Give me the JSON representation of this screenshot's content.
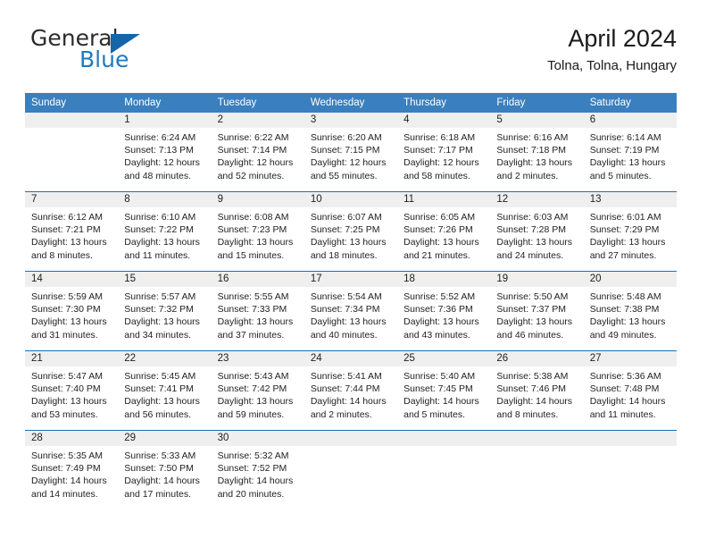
{
  "brand": {
    "name_part1": "General",
    "name_part2": "Blue",
    "logo_icon": "triangle-logo-icon"
  },
  "header": {
    "title": "April 2024",
    "location": "Tolna, Tolna, Hungary"
  },
  "colors": {
    "header_blue": "#3a7fbe",
    "row_separator_blue": "#1f6fb5",
    "daynum_band_gray": "#efefef",
    "brand_blue": "#1f7ac0",
    "logo_blue": "#1565a8"
  },
  "weekdays": [
    "Sunday",
    "Monday",
    "Tuesday",
    "Wednesday",
    "Thursday",
    "Friday",
    "Saturday"
  ],
  "weeks": [
    {
      "days": [
        {
          "num": "",
          "sunrise": "",
          "sunset": "",
          "daylight1": "",
          "daylight2": ""
        },
        {
          "num": "1",
          "sunrise": "Sunrise: 6:24 AM",
          "sunset": "Sunset: 7:13 PM",
          "daylight1": "Daylight: 12 hours",
          "daylight2": "and 48 minutes."
        },
        {
          "num": "2",
          "sunrise": "Sunrise: 6:22 AM",
          "sunset": "Sunset: 7:14 PM",
          "daylight1": "Daylight: 12 hours",
          "daylight2": "and 52 minutes."
        },
        {
          "num": "3",
          "sunrise": "Sunrise: 6:20 AM",
          "sunset": "Sunset: 7:15 PM",
          "daylight1": "Daylight: 12 hours",
          "daylight2": "and 55 minutes."
        },
        {
          "num": "4",
          "sunrise": "Sunrise: 6:18 AM",
          "sunset": "Sunset: 7:17 PM",
          "daylight1": "Daylight: 12 hours",
          "daylight2": "and 58 minutes."
        },
        {
          "num": "5",
          "sunrise": "Sunrise: 6:16 AM",
          "sunset": "Sunset: 7:18 PM",
          "daylight1": "Daylight: 13 hours",
          "daylight2": "and 2 minutes."
        },
        {
          "num": "6",
          "sunrise": "Sunrise: 6:14 AM",
          "sunset": "Sunset: 7:19 PM",
          "daylight1": "Daylight: 13 hours",
          "daylight2": "and 5 minutes."
        }
      ]
    },
    {
      "days": [
        {
          "num": "7",
          "sunrise": "Sunrise: 6:12 AM",
          "sunset": "Sunset: 7:21 PM",
          "daylight1": "Daylight: 13 hours",
          "daylight2": "and 8 minutes."
        },
        {
          "num": "8",
          "sunrise": "Sunrise: 6:10 AM",
          "sunset": "Sunset: 7:22 PM",
          "daylight1": "Daylight: 13 hours",
          "daylight2": "and 11 minutes."
        },
        {
          "num": "9",
          "sunrise": "Sunrise: 6:08 AM",
          "sunset": "Sunset: 7:23 PM",
          "daylight1": "Daylight: 13 hours",
          "daylight2": "and 15 minutes."
        },
        {
          "num": "10",
          "sunrise": "Sunrise: 6:07 AM",
          "sunset": "Sunset: 7:25 PM",
          "daylight1": "Daylight: 13 hours",
          "daylight2": "and 18 minutes."
        },
        {
          "num": "11",
          "sunrise": "Sunrise: 6:05 AM",
          "sunset": "Sunset: 7:26 PM",
          "daylight1": "Daylight: 13 hours",
          "daylight2": "and 21 minutes."
        },
        {
          "num": "12",
          "sunrise": "Sunrise: 6:03 AM",
          "sunset": "Sunset: 7:28 PM",
          "daylight1": "Daylight: 13 hours",
          "daylight2": "and 24 minutes."
        },
        {
          "num": "13",
          "sunrise": "Sunrise: 6:01 AM",
          "sunset": "Sunset: 7:29 PM",
          "daylight1": "Daylight: 13 hours",
          "daylight2": "and 27 minutes."
        }
      ]
    },
    {
      "days": [
        {
          "num": "14",
          "sunrise": "Sunrise: 5:59 AM",
          "sunset": "Sunset: 7:30 PM",
          "daylight1": "Daylight: 13 hours",
          "daylight2": "and 31 minutes."
        },
        {
          "num": "15",
          "sunrise": "Sunrise: 5:57 AM",
          "sunset": "Sunset: 7:32 PM",
          "daylight1": "Daylight: 13 hours",
          "daylight2": "and 34 minutes."
        },
        {
          "num": "16",
          "sunrise": "Sunrise: 5:55 AM",
          "sunset": "Sunset: 7:33 PM",
          "daylight1": "Daylight: 13 hours",
          "daylight2": "and 37 minutes."
        },
        {
          "num": "17",
          "sunrise": "Sunrise: 5:54 AM",
          "sunset": "Sunset: 7:34 PM",
          "daylight1": "Daylight: 13 hours",
          "daylight2": "and 40 minutes."
        },
        {
          "num": "18",
          "sunrise": "Sunrise: 5:52 AM",
          "sunset": "Sunset: 7:36 PM",
          "daylight1": "Daylight: 13 hours",
          "daylight2": "and 43 minutes."
        },
        {
          "num": "19",
          "sunrise": "Sunrise: 5:50 AM",
          "sunset": "Sunset: 7:37 PM",
          "daylight1": "Daylight: 13 hours",
          "daylight2": "and 46 minutes."
        },
        {
          "num": "20",
          "sunrise": "Sunrise: 5:48 AM",
          "sunset": "Sunset: 7:38 PM",
          "daylight1": "Daylight: 13 hours",
          "daylight2": "and 49 minutes."
        }
      ]
    },
    {
      "days": [
        {
          "num": "21",
          "sunrise": "Sunrise: 5:47 AM",
          "sunset": "Sunset: 7:40 PM",
          "daylight1": "Daylight: 13 hours",
          "daylight2": "and 53 minutes."
        },
        {
          "num": "22",
          "sunrise": "Sunrise: 5:45 AM",
          "sunset": "Sunset: 7:41 PM",
          "daylight1": "Daylight: 13 hours",
          "daylight2": "and 56 minutes."
        },
        {
          "num": "23",
          "sunrise": "Sunrise: 5:43 AM",
          "sunset": "Sunset: 7:42 PM",
          "daylight1": "Daylight: 13 hours",
          "daylight2": "and 59 minutes."
        },
        {
          "num": "24",
          "sunrise": "Sunrise: 5:41 AM",
          "sunset": "Sunset: 7:44 PM",
          "daylight1": "Daylight: 14 hours",
          "daylight2": "and 2 minutes."
        },
        {
          "num": "25",
          "sunrise": "Sunrise: 5:40 AM",
          "sunset": "Sunset: 7:45 PM",
          "daylight1": "Daylight: 14 hours",
          "daylight2": "and 5 minutes."
        },
        {
          "num": "26",
          "sunrise": "Sunrise: 5:38 AM",
          "sunset": "Sunset: 7:46 PM",
          "daylight1": "Daylight: 14 hours",
          "daylight2": "and 8 minutes."
        },
        {
          "num": "27",
          "sunrise": "Sunrise: 5:36 AM",
          "sunset": "Sunset: 7:48 PM",
          "daylight1": "Daylight: 14 hours",
          "daylight2": "and 11 minutes."
        }
      ]
    },
    {
      "days": [
        {
          "num": "28",
          "sunrise": "Sunrise: 5:35 AM",
          "sunset": "Sunset: 7:49 PM",
          "daylight1": "Daylight: 14 hours",
          "daylight2": "and 14 minutes."
        },
        {
          "num": "29",
          "sunrise": "Sunrise: 5:33 AM",
          "sunset": "Sunset: 7:50 PM",
          "daylight1": "Daylight: 14 hours",
          "daylight2": "and 17 minutes."
        },
        {
          "num": "30",
          "sunrise": "Sunrise: 5:32 AM",
          "sunset": "Sunset: 7:52 PM",
          "daylight1": "Daylight: 14 hours",
          "daylight2": "and 20 minutes."
        },
        {
          "num": "",
          "sunrise": "",
          "sunset": "",
          "daylight1": "",
          "daylight2": ""
        },
        {
          "num": "",
          "sunrise": "",
          "sunset": "",
          "daylight1": "",
          "daylight2": ""
        },
        {
          "num": "",
          "sunrise": "",
          "sunset": "",
          "daylight1": "",
          "daylight2": ""
        },
        {
          "num": "",
          "sunrise": "",
          "sunset": "",
          "daylight1": "",
          "daylight2": ""
        }
      ]
    }
  ]
}
